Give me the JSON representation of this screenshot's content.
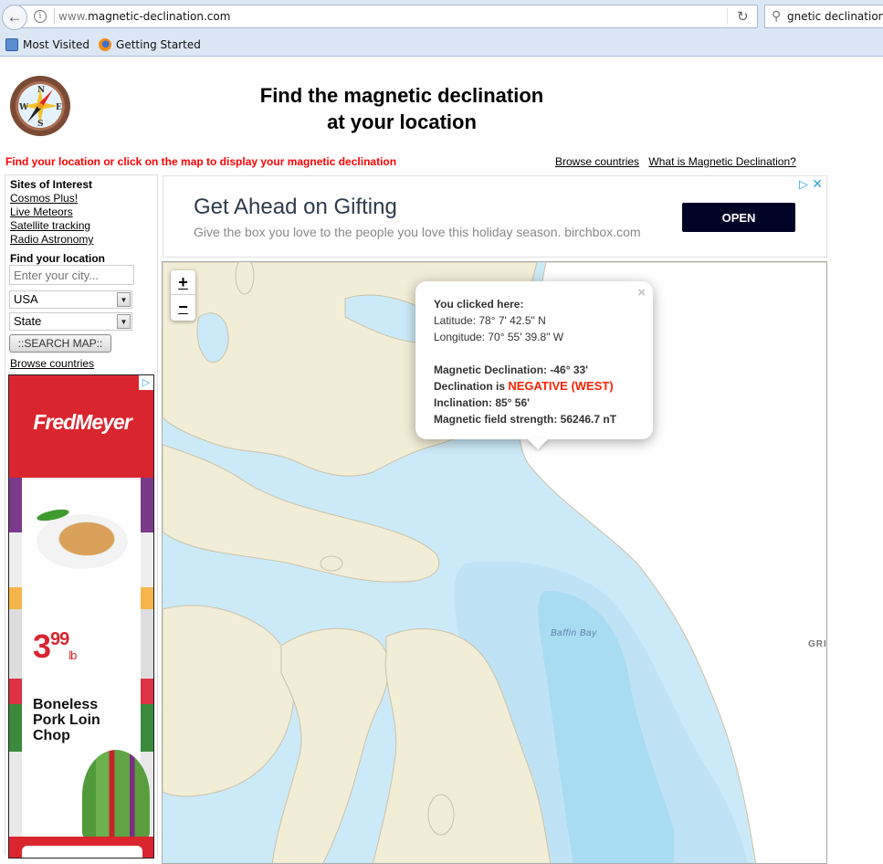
{
  "browser": {
    "url_dim": "www.",
    "url_main": "magnetic-declination.com",
    "search_value": "gnetic declination fo",
    "bookmarks": [
      {
        "label": "Most Visited",
        "icon": "most-visited-icon"
      },
      {
        "label": "Getting Started",
        "icon": "firefox-icon"
      }
    ],
    "icons": {
      "back": "←",
      "info": "i",
      "reload": "↻",
      "search": "🔍"
    }
  },
  "header": {
    "title_line1": "Find the magnetic declination",
    "title_line2": "at your location",
    "instruction": "Find your location or click on the map to display your magnetic declination",
    "links": [
      "Browse countries",
      "What is Magnetic Declination?"
    ]
  },
  "sidebar": {
    "sites_heading": "Sites of Interest",
    "sites": [
      "Cosmos Plus!",
      "Live Meteors",
      "Satellite tracking",
      "Radio Astronomy"
    ],
    "find_heading": "Find your location",
    "city_placeholder": "Enter your city...",
    "country_selected": "USA",
    "state_selected": "State",
    "search_button": "::SEARCH MAP::",
    "browse_link": "Browse countries",
    "select_arrow": "▼"
  },
  "side_ad": {
    "brand": "FredMeyer",
    "price_whole": "3",
    "price_cents": "99",
    "price_unit": "lb",
    "product_lines": [
      "Boneless",
      "Pork Loin",
      "Chop"
    ],
    "adchoice_icon": "▷",
    "brand_color": "#d9262e"
  },
  "banner_ad": {
    "title": "Get Ahead on Gifting",
    "subtitle": "Give the box you love to the people you love this holiday season. birchbox.com",
    "button": "OPEN",
    "adchoice_icon": "▷",
    "close_icon": "✕"
  },
  "map": {
    "zoom_in": "+",
    "zoom_out": "−",
    "labels": {
      "sea": "Baffin Bay",
      "land_partial": "GRI"
    },
    "colors": {
      "land": "#f2edd6",
      "water": "#cce9f7",
      "deep_water": "#a8dcf2",
      "coast": "#c9c3a8"
    }
  },
  "popup": {
    "heading": "You clicked here:",
    "latitude": "Latitude: 78° 7' 42.5\" N",
    "longitude": "Longitude: 70° 55' 39.8\" W",
    "declination": "Magnetic Declination: -46° 33'",
    "declination_prefix": "Declination is ",
    "declination_sign": "NEGATIVE (WEST)",
    "inclination": "Inclination: 85° 56'",
    "field_strength": "Magnetic field strength: 56246.7 nT",
    "close_icon": "×",
    "accent_color": "#ff2200"
  }
}
